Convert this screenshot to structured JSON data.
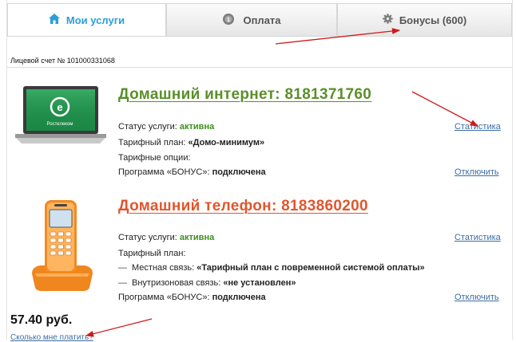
{
  "tabs": [
    {
      "label": "Мои услуги",
      "icon": "home-icon",
      "active": true
    },
    {
      "label": "Оплата",
      "icon": "coin-icon",
      "active": false
    },
    {
      "label": "Бонусы (600)",
      "icon": "gear-icon",
      "active": false
    }
  ],
  "account_label": "Лицевой счет № 101000331068",
  "services": [
    {
      "title": "Домашний интернет: 8181371760",
      "status_label": "Статус услуги:",
      "status_value": "активна",
      "stats_link": "Статистика",
      "tariff_label": "Тарифный план:",
      "tariff_value": "«Домо-минимум»",
      "options_label": "Тарифные опции:",
      "bonus_label": "Программа «БОНУС»:",
      "bonus_value": "подключена",
      "disconnect_link": "Отключить",
      "logo_text": "Ростелеком"
    },
    {
      "title": "Домашний телефон: 8183860200",
      "status_label": "Статус услуги:",
      "status_value": "активна",
      "stats_link": "Статистика",
      "tariff_label": "Тарифный план:",
      "local_label": "Местная связь:",
      "local_value": "«Тарифный план с повременной системой оплаты»",
      "zone_label": "Внутризоновая связь:",
      "zone_value": "«не установлен»",
      "bonus_label": "Программа «БОНУС»:",
      "bonus_value": "подключена",
      "disconnect_link": "Отключить"
    }
  ],
  "balance": "57.40 руб.",
  "how_much_link": "Сколько мне платить?",
  "colors": {
    "accent_blue": "#2a9fd8",
    "green_title": "#5a8f29",
    "red_title": "#e0562d",
    "status_green": "#3d8f1d",
    "link_blue": "#3a6ea5",
    "annotation_arrow": "#d0191b"
  }
}
